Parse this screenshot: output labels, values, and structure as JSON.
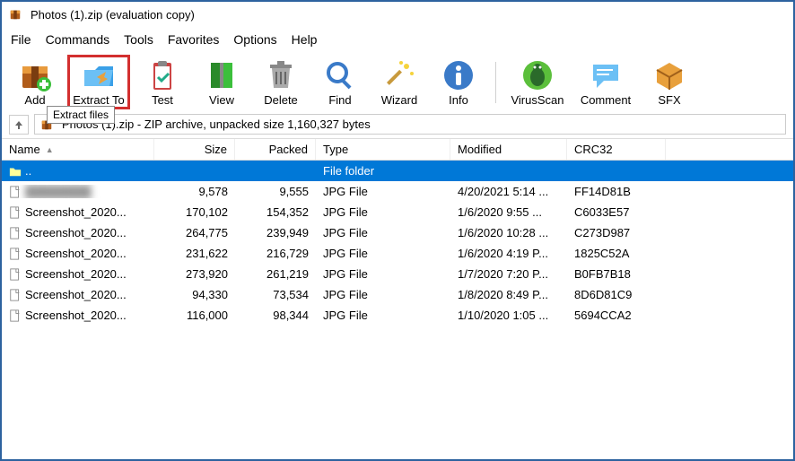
{
  "window": {
    "title": "Photos (1).zip (evaluation copy)"
  },
  "menu": [
    "File",
    "Commands",
    "Tools",
    "Favorites",
    "Options",
    "Help"
  ],
  "toolbar": [
    {
      "id": "add",
      "label": "Add",
      "icon": "archive-add"
    },
    {
      "id": "extract",
      "label": "Extract To",
      "icon": "folder-out",
      "highlighted": true
    },
    {
      "id": "test",
      "label": "Test",
      "icon": "clipboard-check"
    },
    {
      "id": "view",
      "label": "View",
      "icon": "book"
    },
    {
      "id": "delete",
      "label": "Delete",
      "icon": "trash"
    },
    {
      "id": "find",
      "label": "Find",
      "icon": "magnifier"
    },
    {
      "id": "wizard",
      "label": "Wizard",
      "icon": "wand"
    },
    {
      "id": "info",
      "label": "Info",
      "icon": "info"
    },
    {
      "sep": true
    },
    {
      "id": "virus",
      "label": "VirusScan",
      "icon": "bug"
    },
    {
      "id": "comment",
      "label": "Comment",
      "icon": "chat"
    },
    {
      "id": "sfx",
      "label": "SFX",
      "icon": "box"
    }
  ],
  "tooltip": "Extract files",
  "pathbar": {
    "text": "Photos (1).zip - ZIP archive, unpacked size 1,160,327 bytes"
  },
  "columns": {
    "name": "Name",
    "size": "Size",
    "packed": "Packed",
    "type": "Type",
    "modified": "Modified",
    "crc": "CRC32"
  },
  "rows": [
    {
      "selected": true,
      "name": "..",
      "size": "",
      "packed": "",
      "type": "File folder",
      "modified": "",
      "crc": "",
      "kind": "updir",
      "centerType": true
    },
    {
      "name": "████████",
      "blurred": true,
      "size": "9,578",
      "packed": "9,555",
      "type": "JPG File",
      "modified": "4/20/2021 5:14 ...",
      "crc": "FF14D81B",
      "kind": "file"
    },
    {
      "name": "Screenshot_2020...",
      "size": "170,102",
      "packed": "154,352",
      "type": "JPG File",
      "modified": "1/6/2020 9:55 ...",
      "crc": "C6033E57",
      "kind": "file"
    },
    {
      "name": "Screenshot_2020...",
      "size": "264,775",
      "packed": "239,949",
      "type": "JPG File",
      "modified": "1/6/2020 10:28 ...",
      "crc": "C273D987",
      "kind": "file"
    },
    {
      "name": "Screenshot_2020...",
      "size": "231,622",
      "packed": "216,729",
      "type": "JPG File",
      "modified": "1/6/2020 4:19 P...",
      "crc": "1825C52A",
      "kind": "file"
    },
    {
      "name": "Screenshot_2020...",
      "size": "273,920",
      "packed": "261,219",
      "type": "JPG File",
      "modified": "1/7/2020 7:20 P...",
      "crc": "B0FB7B18",
      "kind": "file"
    },
    {
      "name": "Screenshot_2020...",
      "size": "94,330",
      "packed": "73,534",
      "type": "JPG File",
      "modified": "1/8/2020 8:49 P...",
      "crc": "8D6D81C9",
      "kind": "file"
    },
    {
      "name": "Screenshot_2020...",
      "size": "116,000",
      "packed": "98,344",
      "type": "JPG File",
      "modified": "1/10/2020 1:05 ...",
      "crc": "5694CCA2",
      "kind": "file"
    }
  ]
}
